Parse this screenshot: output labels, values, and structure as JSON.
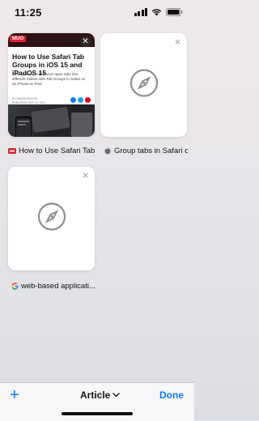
{
  "status_bar": {
    "time": "11:25",
    "icons": [
      "cellular-signal-icon",
      "wifi-icon",
      "battery-icon"
    ]
  },
  "tabs": [
    {
      "title": "How to Use Safari Tab Groups in iOS 15 and iPadOS 15",
      "favicon": "red-site-favicon-icon",
      "preview": {
        "logo_text": "MUO",
        "heading": "How to Use Safari Tab Groups in iOS 15 and iPadOS 15",
        "summary": "Learn how to collect your open tabs into different folders with Tab Groups in Safari on an iPhone or iPad.",
        "meta_line1": "BY NAMAN BHASIN",
        "meta_line2": "PUBLISHED SEP 10, 2021",
        "share_colors": [
          "#1877f2",
          "#1da1f2",
          "#e60023"
        ],
        "close_icon": "close-icon"
      }
    },
    {
      "title": "Group tabs in Safari on",
      "favicon": "apple-icon",
      "icon": "compass-icon"
    },
    {
      "title": "web-based applicati...",
      "favicon": "google-icon",
      "icon": "compass-icon"
    }
  ],
  "toolbar": {
    "new_tab_label": "+",
    "group_label": "Article",
    "group_chevron": "chevron-down-icon",
    "done_label": "Done"
  },
  "colors": {
    "accent": "#0a7aff",
    "background": "#ebe8eb"
  }
}
